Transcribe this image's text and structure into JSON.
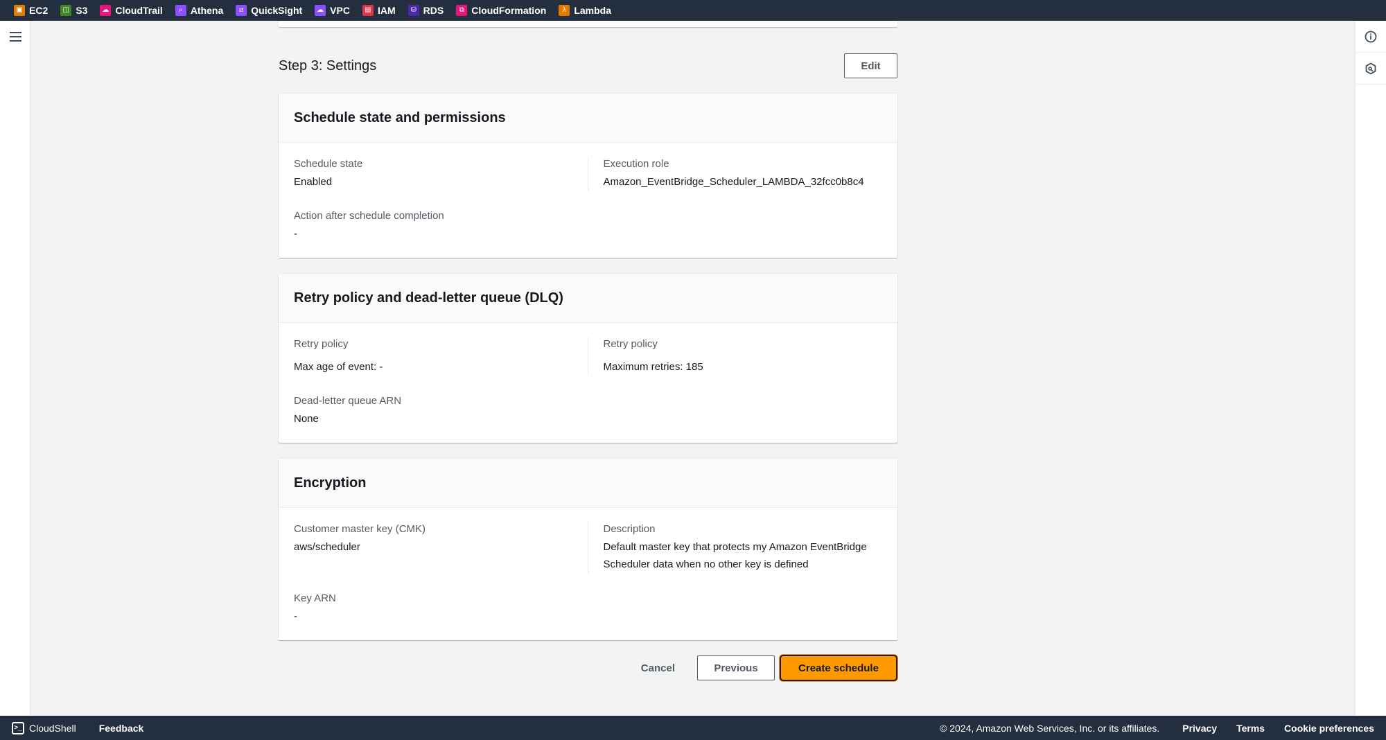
{
  "topbar": {
    "services": [
      {
        "label": "EC2",
        "icon": "ec2-icon",
        "color": "#e07b00"
      },
      {
        "label": "S3",
        "icon": "s3-icon",
        "color": "#3f8624"
      },
      {
        "label": "CloudTrail",
        "icon": "cloudtrail-icon",
        "color": "#e7157b"
      },
      {
        "label": "Athena",
        "icon": "athena-icon",
        "color": "#8c4fff"
      },
      {
        "label": "QuickSight",
        "icon": "quicksight-icon",
        "color": "#8c4fff"
      },
      {
        "label": "VPC",
        "icon": "vpc-icon",
        "color": "#8c4fff"
      },
      {
        "label": "IAM",
        "icon": "iam-icon",
        "color": "#dd344c"
      },
      {
        "label": "RDS",
        "icon": "rds-icon",
        "color": "#4d27aa"
      },
      {
        "label": "CloudFormation",
        "icon": "cloudformation-icon",
        "color": "#e7157b"
      },
      {
        "label": "Lambda",
        "icon": "lambda-icon",
        "color": "#e07b00"
      }
    ]
  },
  "step": {
    "title": "Step 3: Settings",
    "edit_label": "Edit"
  },
  "sections": {
    "schedule_state": {
      "title": "Schedule state and permissions",
      "schedule_state_label": "Schedule state",
      "schedule_state_value": "Enabled",
      "execution_role_label": "Execution role",
      "execution_role_value": "Amazon_EventBridge_Scheduler_LAMBDA_32fcc0b8c4",
      "action_after_label": "Action after schedule completion",
      "action_after_value": "-"
    },
    "retry": {
      "title": "Retry policy and dead-letter queue (DLQ)",
      "retry_policy_label_1": "Retry policy",
      "retry_policy_value_1": "Max age of event: -",
      "retry_policy_label_2": "Retry policy",
      "retry_policy_value_2": "Maximum retries: 185",
      "dlq_label": "Dead-letter queue ARN",
      "dlq_value": "None"
    },
    "encryption": {
      "title": "Encryption",
      "cmk_label": "Customer master key (CMK)",
      "cmk_value": "aws/scheduler",
      "description_label": "Description",
      "description_value": "Default master key that protects my Amazon EventBridge Scheduler data when no other key is defined",
      "key_arn_label": "Key ARN",
      "key_arn_value": "-"
    }
  },
  "actions": {
    "cancel_label": "Cancel",
    "previous_label": "Previous",
    "create_label": "Create schedule",
    "primary_color": "#ff9900"
  },
  "footer": {
    "cloudshell_label": "CloudShell",
    "feedback_label": "Feedback",
    "copyright": "© 2024, Amazon Web Services, Inc. or its affiliates.",
    "privacy_label": "Privacy",
    "terms_label": "Terms",
    "cookie_label": "Cookie preferences"
  }
}
